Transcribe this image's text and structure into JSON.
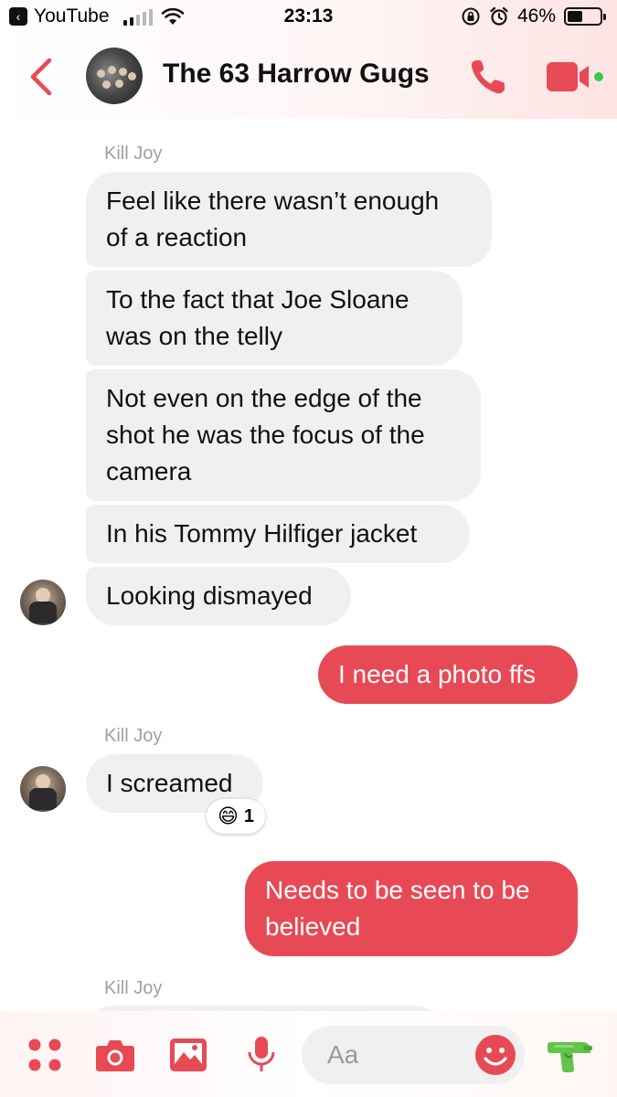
{
  "status_bar": {
    "back_app": "YouTube",
    "time": "23:13",
    "battery_percent": "46%",
    "battery_level": 0.46
  },
  "conversation": {
    "title": "The 63 Harrow Gugs"
  },
  "messages": [
    {
      "sender": "Kill Joy"
    },
    {
      "text": "Feel like there wasn’t enough of a reaction",
      "line1": "Feel like there wasn’t enough",
      "line2": "of a reaction"
    },
    {
      "line1": "To the fact that Joe Sloane",
      "line2": "was on the telly"
    },
    {
      "line1": "Not even on the edge of the",
      "line2": "shot he was the focus of the",
      "line3": "camera"
    },
    {
      "text": "In his Tommy Hilfiger jacket"
    },
    {
      "text": "Looking dismayed"
    },
    {
      "text": "I need a photo ffs"
    },
    {
      "sender": "Kill Joy"
    },
    {
      "text": "I screamed",
      "reaction_emoji": "😄",
      "reaction_count": "1"
    },
    {
      "line1": "Needs to be seen to be",
      "line2": "believed"
    },
    {
      "sender": "Kill Joy"
    }
  ],
  "composer": {
    "placeholder": "Aa"
  },
  "colors": {
    "accent": "#e84a55",
    "incoming_bubble": "#f0f0f0",
    "sender_label": "#a0a0a0"
  },
  "icons": [
    "back-chevron-icon",
    "phone-icon",
    "video-camera-icon",
    "apps-grid-icon",
    "camera-icon",
    "gallery-icon",
    "microphone-icon",
    "emoji-icon",
    "water-gun-icon"
  ]
}
